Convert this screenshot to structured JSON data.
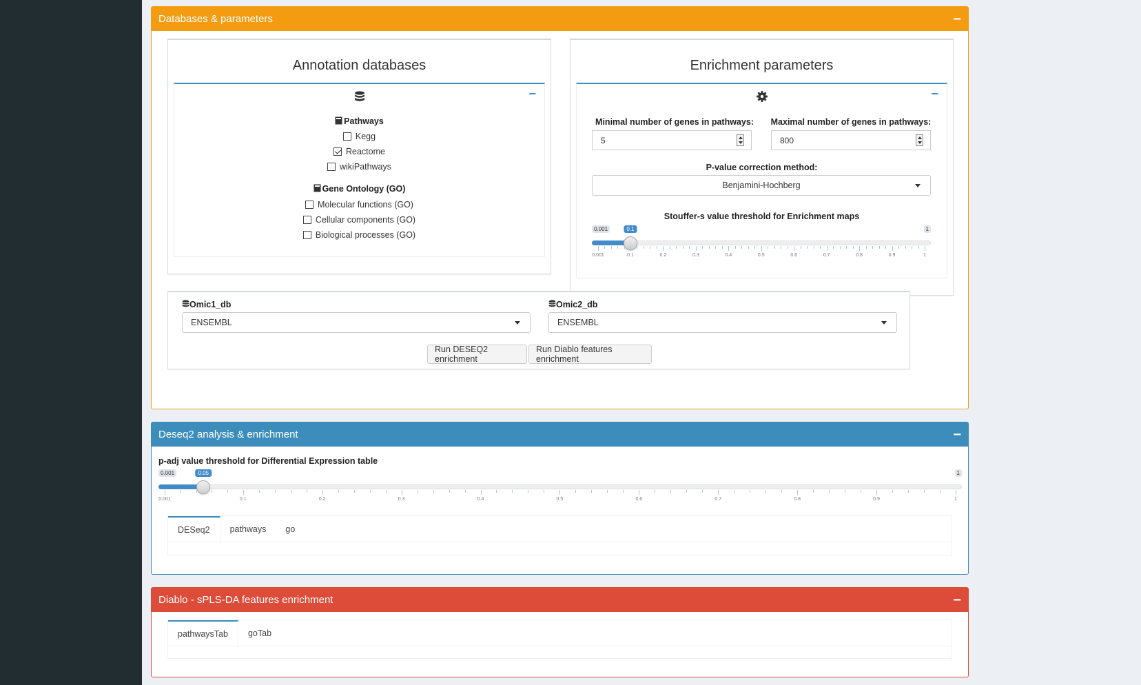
{
  "colors": {
    "orange": "#f39c12",
    "blue": "#3c8dbc",
    "red": "#dd4b39",
    "sidebar": "#222d32"
  },
  "box1": {
    "title": "Databases & parameters",
    "annotation": {
      "title": "Annotation databases",
      "header_icon": "database-icon",
      "pathways_title": "Pathways",
      "pathways": [
        {
          "label": "Kegg",
          "checked": false
        },
        {
          "label": "Reactome",
          "checked": true
        },
        {
          "label": "wikiPathways",
          "checked": false
        }
      ],
      "go_title": "Gene Ontology (GO)",
      "go": [
        {
          "label": "Molecular functions (GO)",
          "checked": false
        },
        {
          "label": "Cellular components (GO)",
          "checked": false
        },
        {
          "label": "Biological processes (GO)",
          "checked": false
        }
      ]
    },
    "enrichment": {
      "title": "Enrichment parameters",
      "header_icon": "gear-icon",
      "min_label": "Minimal number of genes in pathways:",
      "min_value": "5",
      "max_label": "Maximal number of genes in pathways:",
      "max_value": "800",
      "pvalue_label": "P-value correction method:",
      "pvalue_method": "Benjamini-Hochberg",
      "stouffer_label": "Stouffer-s value threshold for Enrichment maps",
      "stouffer_slider": {
        "min": 0.001,
        "max": 1,
        "value": 0.1,
        "min_label": "0.001",
        "max_label": "1",
        "value_label": "0.1",
        "ticks": [
          "0.001",
          "0.1",
          "0.2",
          "0.3",
          "0.4",
          "0.5",
          "0.6",
          "0.7",
          "0.8",
          "0.9",
          "1"
        ]
      }
    },
    "omic1_label": "Omic1_db",
    "omic1_value": "ENSEMBL",
    "omic2_label": "Omic2_db",
    "omic2_value": "ENSEMBL",
    "run_deseq2": "Run DESEQ2 enrichment",
    "run_diablo": "Run Diablo features enrichment"
  },
  "box2": {
    "title": "Deseq2 analysis & enrichment",
    "padj_label": "p-adj value threshold for Differential Expression table",
    "padj_slider": {
      "min": 0.001,
      "max": 1,
      "value": 0.05,
      "min_label": "0.001",
      "max_label": "1",
      "value_label": "0.05",
      "ticks": [
        "0.001",
        "0.1",
        "0.2",
        "0.3",
        "0.4",
        "0.5",
        "0.6",
        "0.7",
        "0.8",
        "0.9",
        "1"
      ]
    },
    "tabs": [
      "DESeq2",
      "pathways",
      "go"
    ]
  },
  "box3": {
    "title": "Diablo - sPLS-DA features enrichment",
    "tabs": [
      "pathwaysTab",
      "goTab"
    ]
  }
}
